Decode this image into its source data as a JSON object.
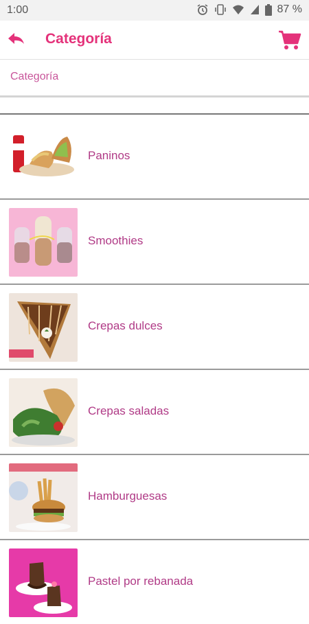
{
  "status_bar": {
    "time": "1:00",
    "battery": "87 %"
  },
  "app_bar": {
    "title": "Categoría"
  },
  "breadcrumb": {
    "text": "Categoría"
  },
  "categories": [
    {
      "label": "Paninos",
      "thumb": "panino-photo"
    },
    {
      "label": "Smoothies",
      "thumb": "smoothie-photo"
    },
    {
      "label": "Crepas dulces",
      "thumb": "sweet-crepe-photo"
    },
    {
      "label": "Crepas saladas",
      "thumb": "savory-crepe-photo"
    },
    {
      "label": "Hamburguesas",
      "thumb": "burger-photo"
    },
    {
      "label": "Pastel por rebanada",
      "thumb": "cake-photo"
    }
  ],
  "colors": {
    "accent": "#e4327a",
    "label": "#b03a86"
  }
}
